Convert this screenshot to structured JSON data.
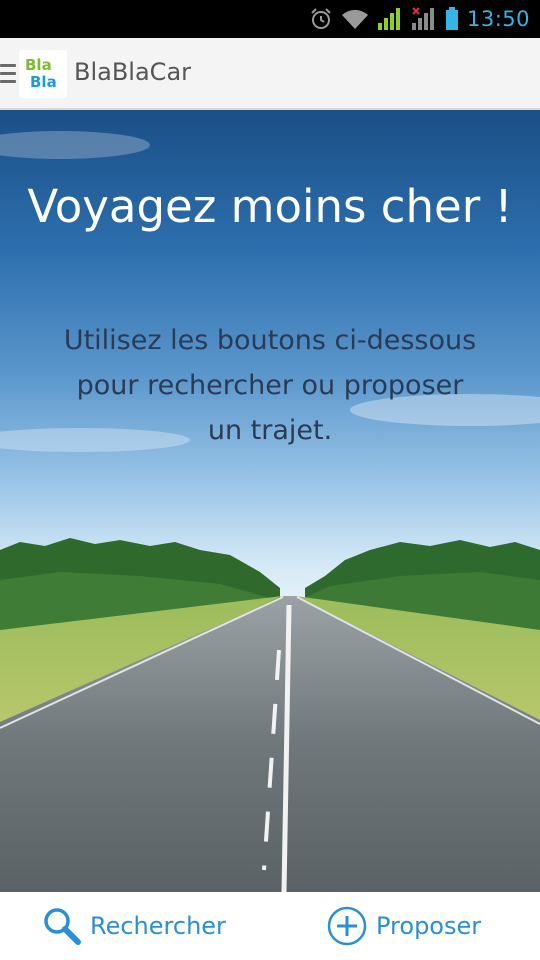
{
  "status_bar": {
    "time": "13:50",
    "icons": [
      "alarm-icon",
      "wifi-icon",
      "signal-icon",
      "signal-no-sim-icon",
      "battery-icon"
    ]
  },
  "action_bar": {
    "logo_line1": "Bla",
    "logo_line2": "Bla",
    "title": "BlaBlaCar",
    "icons": [
      "menu-icon"
    ]
  },
  "hero": {
    "title": "Voyagez moins cher !",
    "subtitle": "Utilisez les boutons ci-dessous pour rechercher ou proposer un trajet."
  },
  "bottom_bar": {
    "search_label": "Rechercher",
    "propose_label": "Proposer",
    "icons": [
      "search-icon",
      "plus-circle-icon"
    ]
  },
  "colors": {
    "accent": "#2a8fd4",
    "status_accent": "#33b5e5",
    "logo_green": "#7fbb33",
    "logo_blue": "#1c9bd9"
  }
}
